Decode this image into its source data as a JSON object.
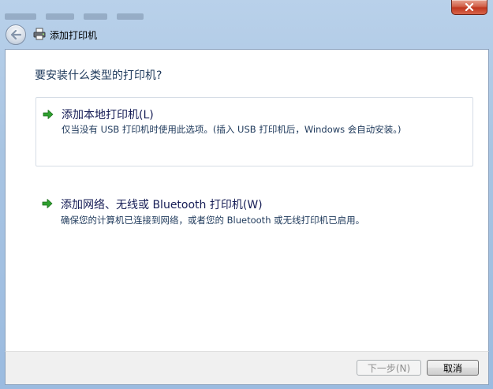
{
  "window": {
    "title": "添加打印机",
    "close_label": "×"
  },
  "main": {
    "question": "要安装什么类型的打印机?",
    "options": [
      {
        "title": "添加本地打印机(L)",
        "description": "仅当没有 USB 打印机时使用此选项。(插入 USB 打印机后，Windows 会自动安装。)"
      },
      {
        "title": "添加网络、无线或 Bluetooth 打印机(W)",
        "description": "确保您的计算机已连接到网络，或者您的 Bluetooth 或无线打印机已启用。"
      }
    ]
  },
  "footer": {
    "next_label": "下一步(N)",
    "cancel_label": "取消"
  },
  "colors": {
    "question_text": "#1e395b",
    "option_title": "#151c55",
    "arrow_green": "#2fa02f",
    "close_red": "#c0371f"
  },
  "icons": {
    "back": "back-arrow-icon",
    "printer": "printer-icon",
    "option_arrow": "green-arrow-icon",
    "close": "close-icon"
  }
}
